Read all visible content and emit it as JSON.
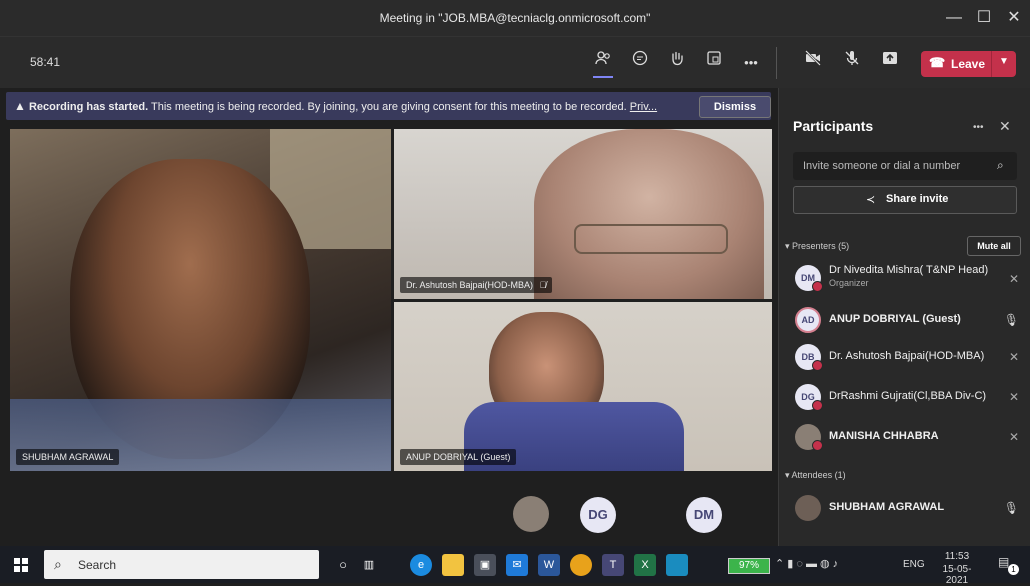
{
  "window": {
    "title": "Meeting in \"JOB.MBA@tecniaclg.onmicrosoft.com\"",
    "min_label": "—",
    "max_label": "☐",
    "close_label": "✕"
  },
  "toolbar": {
    "timer": "58:41",
    "leave_label": "Leave",
    "more_label": "•••"
  },
  "banner": {
    "bold": "Recording has started.",
    "text": "This meeting is being recorded. By joining, you are giving consent for this meeting to be recorded.",
    "link": "Priv...",
    "dismiss_label": "Dismiss"
  },
  "tiles": [
    {
      "name": "SHUBHAM AGRAWAL"
    },
    {
      "name": "Dr. Ashutosh Bajpai(HOD-MBA)"
    },
    {
      "name": "ANUP DOBRIYAL (Guest)"
    }
  ],
  "bottom_avatars": [
    {
      "initials": "DG"
    },
    {
      "initials": "DM"
    }
  ],
  "participants": {
    "title": "Participants",
    "more_label": "•••",
    "close_label": "✕",
    "invite_placeholder": "Invite someone or dial a number",
    "share_invite_label": "Share invite",
    "presenters_label": "Presenters (5)",
    "mute_all_label": "Mute all",
    "presenters": [
      {
        "initials": "DM",
        "name": "Dr Nivedita Mishra( T&NP Head)",
        "role": "Organizer"
      },
      {
        "initials": "AD",
        "name": "ANUP DOBRIYAL (Guest)"
      },
      {
        "initials": "DB",
        "name": "Dr. Ashutosh Bajpai(HOD-MBA)"
      },
      {
        "initials": "DG",
        "name": "DrRashmi Gujrati(Cl,BBA Div-C)"
      },
      {
        "initials": "",
        "name": "MANISHA CHHABRA"
      }
    ],
    "attendees_label": "Attendees (1)",
    "attendees": [
      {
        "initials": "",
        "name": "SHUBHAM AGRAWAL"
      }
    ]
  },
  "taskbar": {
    "search_label": "Search",
    "battery": "97%",
    "lang": "ENG",
    "time": "11:53",
    "date": "15-05-2021",
    "notif_count": "1"
  },
  "colors": {
    "accent": "#6264a7",
    "leave": "#c4314b",
    "banner": "#393a5c"
  }
}
